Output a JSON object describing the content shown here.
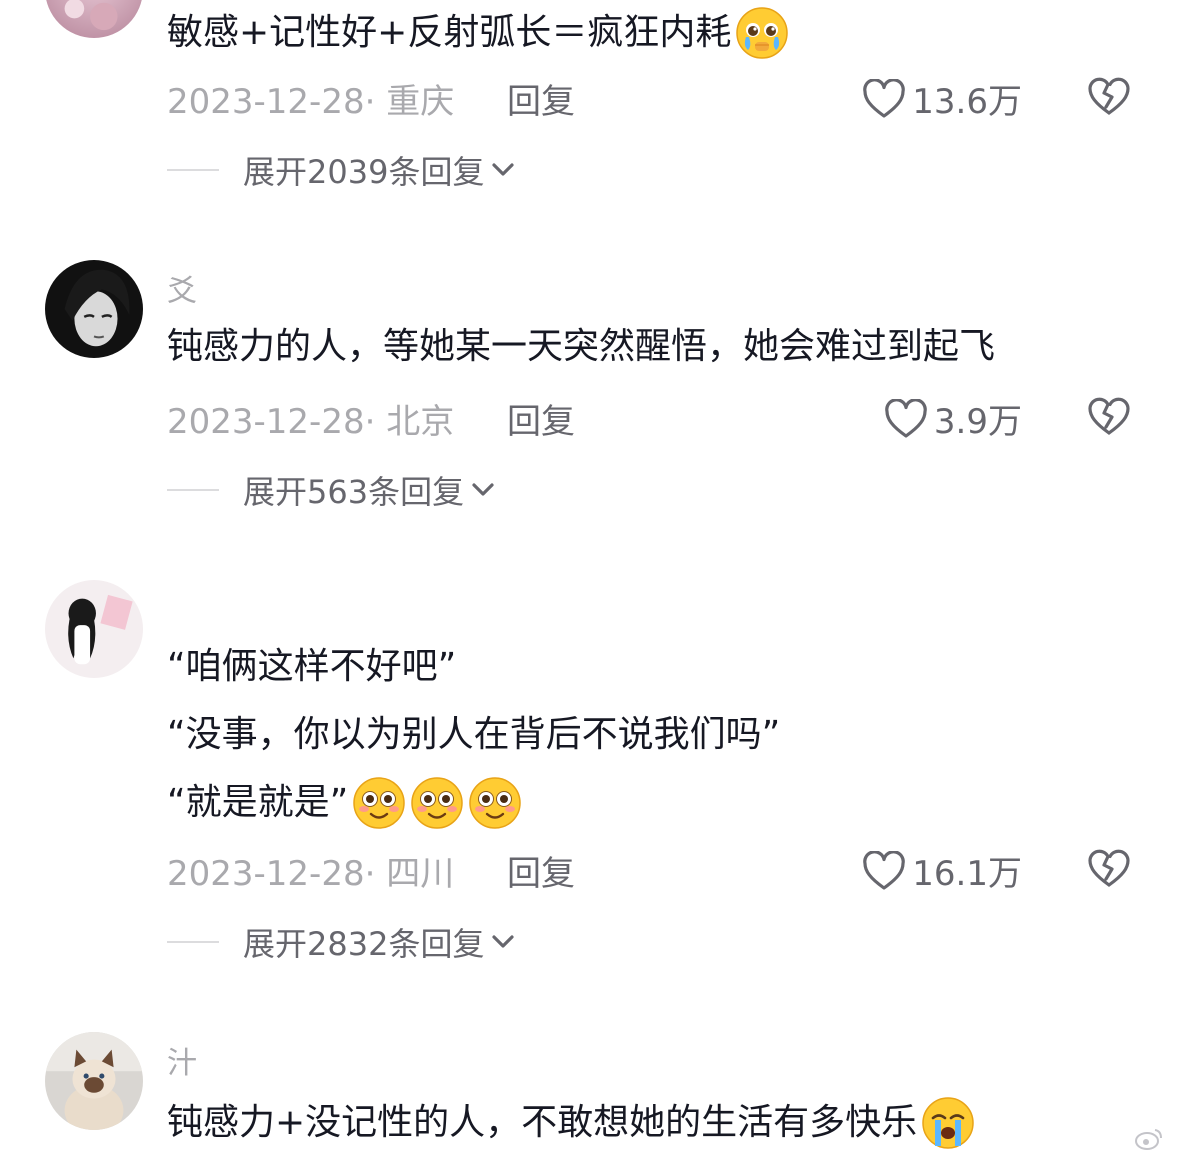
{
  "comments": [
    {
      "username": "",
      "lines": [
        "敏感+记性好+反射弧长＝疯狂内耗"
      ],
      "emoji": [
        "pleading-crying-face-icon"
      ],
      "date": "2023-12-28",
      "location": "· 重庆",
      "reply_label": "回复",
      "likes": "13.6万",
      "expand_label": "展开2039条回复"
    },
    {
      "username": "爻",
      "lines": [
        "钝感力的人，等她某一天突然醒悟，她会难过到起飞"
      ],
      "emoji": [],
      "date": "2023-12-28",
      "location": "· 北京",
      "reply_label": "回复",
      "likes": "3.9万",
      "expand_label": "展开563条回复"
    },
    {
      "username": "",
      "lines": [
        "“咱俩这样不好吧”",
        "“没事，你以为别人在背后不说我们吗”",
        "“就是就是”"
      ],
      "emoji": [
        "flushed-face-icon",
        "flushed-face-icon",
        "flushed-face-icon"
      ],
      "date": "2023-12-28",
      "location": "· 四川",
      "reply_label": "回复",
      "likes": "16.1万",
      "expand_label": "展开2832条回复"
    },
    {
      "username": "汁",
      "lines": [
        "钝感力+没记性的人，不敢想她的生活有多快乐"
      ],
      "emoji": [
        "loudly-crying-face-icon"
      ]
    }
  ],
  "colors": {
    "text_primary": "#161823",
    "text_secondary": "#a9a9ad",
    "text_action": "#66666d",
    "divider": "#dcdcde",
    "emoji_yellow": "#ffcc33"
  },
  "icons": [
    "heart-outline-icon",
    "broken-heart-icon",
    "chevron-down-icon",
    "weibo-icon"
  ]
}
